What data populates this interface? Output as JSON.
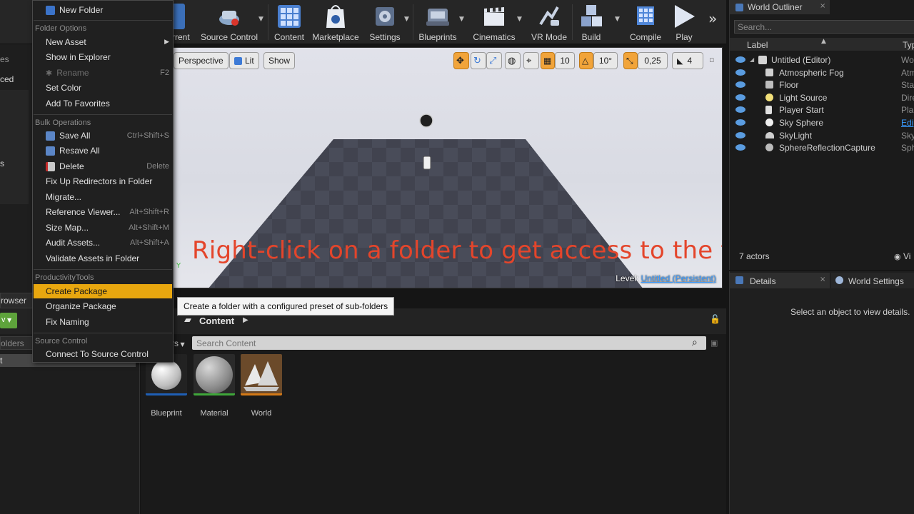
{
  "toolbar": {
    "items": [
      {
        "label": "urrent"
      },
      {
        "label": "Source Control"
      },
      {
        "label": "Content"
      },
      {
        "label": "Marketplace"
      },
      {
        "label": "Settings"
      },
      {
        "label": "Blueprints"
      },
      {
        "label": "Cinematics"
      },
      {
        "label": "VR Mode"
      },
      {
        "label": "Build"
      },
      {
        "label": "Compile"
      },
      {
        "label": "Play"
      }
    ],
    "more_glyph": "»"
  },
  "viewport": {
    "perspective_label": "Perspective",
    "lit_label": "Lit",
    "show_label": "Show",
    "grid_snap": "10",
    "rotation_snap": "10°",
    "scale_snap": "0,25",
    "camera_speed": "4",
    "caption": "Right-click on a folder to get access to the tools",
    "level_label": "Level:",
    "level_value": "Untitled (Persistent)"
  },
  "left_fragments": {
    "tab1": "es",
    "tab2": "ced",
    "item": "s"
  },
  "context_menu": {
    "new_folder": "New Folder",
    "sections": {
      "folder_options": "Folder Options",
      "bulk_operations": "Bulk Operations",
      "productivity_tools": "ProductivityTools",
      "source_control": "Source Control"
    },
    "items": {
      "new_asset": "New Asset",
      "show_in_explorer": "Show in Explorer",
      "rename": "Rename",
      "rename_shortcut": "F2",
      "set_color": "Set Color",
      "add_to_favorites": "Add To Favorites",
      "save_all": "Save All",
      "save_all_shortcut": "Ctrl+Shift+S",
      "resave_all": "Resave All",
      "delete": "Delete",
      "delete_shortcut": "Delete",
      "fix_up_redirectors": "Fix Up Redirectors in Folder",
      "migrate": "Migrate...",
      "reference_viewer": "Reference Viewer...",
      "reference_viewer_shortcut": "Alt+Shift+R",
      "size_map": "Size Map...",
      "size_map_shortcut": "Alt+Shift+M",
      "audit_assets": "Audit Assets...",
      "audit_assets_shortcut": "Alt+Shift+A",
      "validate_assets": "Validate Assets in Folder",
      "create_package": "Create Package",
      "organize_package": "Organize Package",
      "fix_naming": "Fix Naming",
      "connect_to_source_control": "Connect To Source Control"
    }
  },
  "tooltip": "Create a folder with a configured preset of sub-folders",
  "content_browser": {
    "tab_label": "rowser",
    "path_label": "Content",
    "filters_fragment": "rs",
    "folders_search": "olders",
    "folder_row": "t",
    "search_placeholder": "Search Content",
    "add_fragment": "v",
    "assets": [
      {
        "label": "Blueprint",
        "underline": "#1f5fb5"
      },
      {
        "label": "Material",
        "underline": "#3fa63a"
      },
      {
        "label": "World",
        "underline": "#d47a17"
      }
    ]
  },
  "world_outliner": {
    "tab_label": "World Outliner",
    "search_placeholder": "Search...",
    "col_label": "Label",
    "col_type": "Typ",
    "rows": [
      {
        "label": "Untitled (Editor)",
        "type": "Wor"
      },
      {
        "label": "Atmospheric Fog",
        "type": "Atm"
      },
      {
        "label": "Floor",
        "type": "Stat"
      },
      {
        "label": "Light Source",
        "type": "Dire"
      },
      {
        "label": "Player Start",
        "type": "Pla"
      },
      {
        "label": "Sky Sphere",
        "type": "Edi"
      },
      {
        "label": "SkyLight",
        "type": "Sky"
      },
      {
        "label": "SphereReflectionCapture",
        "type": "Sph"
      }
    ],
    "actor_count": "7 actors",
    "view_fragment": "Vi"
  },
  "details": {
    "tab_label": "Details",
    "world_settings_label": "World Settings",
    "empty_message": "Select an object to view details."
  },
  "colors": {
    "accent": "#e8a70f",
    "caption": "#e4452b",
    "link": "#3a9bff"
  }
}
